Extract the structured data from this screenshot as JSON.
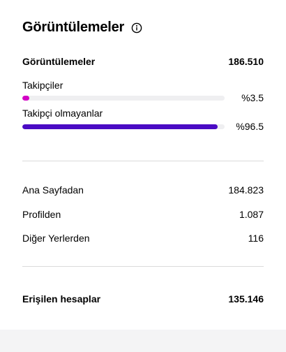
{
  "header": {
    "title": "Görüntülemeler",
    "info_icon": "info-circle-icon"
  },
  "views_total": {
    "label": "Görüntülemeler",
    "value": "186.510"
  },
  "audience": [
    {
      "label": "Takipçiler",
      "percent_text": "%3.5",
      "fraction": 0.035,
      "color": "#d300c5"
    },
    {
      "label": "Takipçi olmayanlar",
      "percent_text": "%96.5",
      "fraction": 0.965,
      "color": "#4a0bc4"
    }
  ],
  "sources": [
    {
      "label": "Ana Sayfadan",
      "value": "184.823"
    },
    {
      "label": "Profilden",
      "value": "1.087"
    },
    {
      "label": "Diğer Yerlerden",
      "value": "116"
    }
  ],
  "reached": {
    "label": "Erişilen hesaplar",
    "value": "135.146"
  },
  "colors": {
    "track": "#efeff1",
    "divider": "#dbdbdb",
    "footer_bg": "#f4f4f5"
  }
}
